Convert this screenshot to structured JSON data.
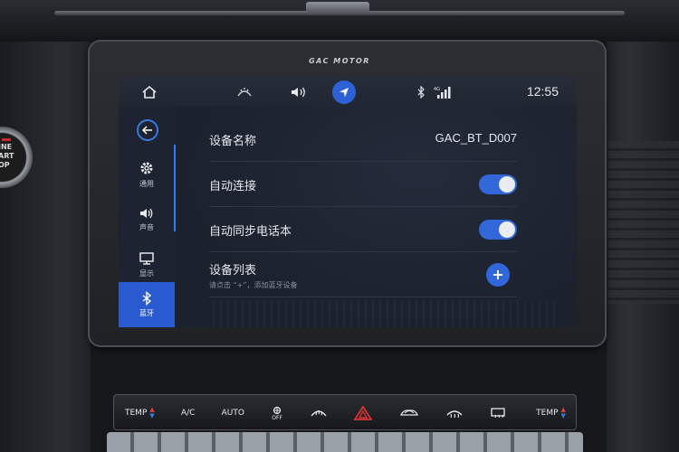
{
  "brand": "GAC MOTOR",
  "start_button": {
    "line1": "INE",
    "line2": "ART",
    "line3": "OP"
  },
  "statusbar": {
    "time": "12:55",
    "signal_label": "4G",
    "icons": [
      "home-icon",
      "wiper-icon",
      "volume-icon",
      "navigation-arrow-icon",
      "bluetooth-icon",
      "signal-bars-icon"
    ]
  },
  "sidebar": {
    "back_icon": "back-arrow-icon",
    "items": [
      {
        "label": "通用",
        "icon": "gear-icon",
        "active": false
      },
      {
        "label": "声音",
        "icon": "speaker-icon",
        "active": false
      },
      {
        "label": "显示",
        "icon": "monitor-icon",
        "active": false
      },
      {
        "label": "蓝牙",
        "icon": "bluetooth-icon",
        "active": true
      }
    ]
  },
  "bluetooth": {
    "device_name_label": "设备名称",
    "device_name_value": "GAC_BT_D007",
    "auto_connect_label": "自动连接",
    "auto_connect_on": true,
    "sync_phonebook_label": "自动同步电话本",
    "sync_phonebook_on": true,
    "device_list_label": "设备列表",
    "device_list_hint": "请点击 “+”，添加蓝牙设备"
  },
  "climate": {
    "temp_left": "TEMP",
    "ac": "A/C",
    "auto": "AUTO",
    "fan_off": "OFF",
    "temp_right": "TEMP",
    "icons": [
      "fan-off-icon",
      "windshield-defrost-icon",
      "hazard-icon",
      "recirculation-icon",
      "front-defrost-icon",
      "rear-defrost-icon"
    ],
    "hazard_color": "#d93434",
    "accent_blue": "#3b78e6",
    "accent_red": "#e23b3b"
  }
}
